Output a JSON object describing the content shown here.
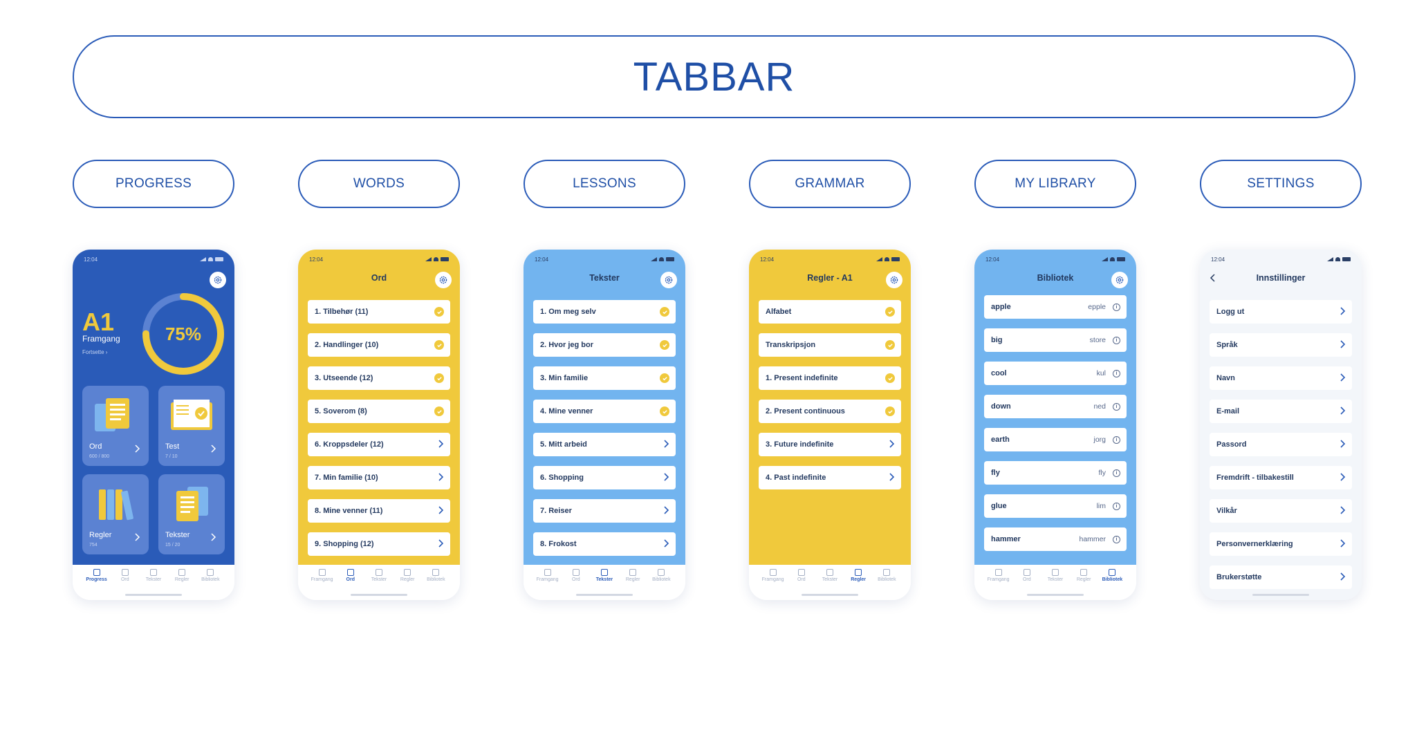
{
  "banner": "TABBAR",
  "pills": [
    "PROGRESS",
    "WORDS",
    "LESSONS",
    "GRAMMAR",
    "MY LIBRARY",
    "SETTINGS"
  ],
  "time": "12:04",
  "tabs": [
    "Framgang",
    "Ord",
    "Tekster",
    "Regler",
    "Bibliotek"
  ],
  "progress": {
    "tabs": [
      "Progress",
      "Ord",
      "Tekster",
      "Regler",
      "Bibliotek"
    ],
    "level": "A1",
    "level_sub": "Framgang",
    "continue": "Fortsette",
    "percent_label": "75%",
    "percent": 0.75,
    "cards": [
      {
        "title": "Ord",
        "sub": "600 / 800"
      },
      {
        "title": "Test",
        "sub": "7 / 10"
      },
      {
        "title": "Regler",
        "sub": "754"
      },
      {
        "title": "Tekster",
        "sub": "15 / 20"
      }
    ]
  },
  "words": {
    "title": "Ord",
    "items": [
      {
        "label": "1. Tilbehør (11)",
        "done": true
      },
      {
        "label": "2. Handlinger (10)",
        "done": true
      },
      {
        "label": "3. Utseende (12)",
        "done": true
      },
      {
        "label": "5. Soverom (8)",
        "done": true
      },
      {
        "label": "6. Kroppsdeler (12)",
        "done": false
      },
      {
        "label": "7. Min familie (10)",
        "done": false
      },
      {
        "label": "8. Mine venner (11)",
        "done": false
      },
      {
        "label": "9. Shopping (12)",
        "done": false
      }
    ]
  },
  "lessons": {
    "title": "Tekster",
    "items": [
      {
        "label": "1. Om meg selv",
        "done": true
      },
      {
        "label": "2. Hvor jeg bor",
        "done": true
      },
      {
        "label": "3. Min familie",
        "done": true
      },
      {
        "label": "4. Mine venner",
        "done": true
      },
      {
        "label": "5. Mitt arbeid",
        "done": false
      },
      {
        "label": "6. Shopping",
        "done": false
      },
      {
        "label": "7. Reiser",
        "done": false
      },
      {
        "label": "8. Frokost",
        "done": false
      }
    ]
  },
  "grammar": {
    "title": "Regler - A1",
    "items": [
      {
        "label": "Alfabet",
        "done": true
      },
      {
        "label": "Transkripsjon",
        "done": true
      },
      {
        "label": "1. Present indefinite",
        "done": true
      },
      {
        "label": "2. Present continuous",
        "done": true
      },
      {
        "label": "3. Future indefinite",
        "done": false
      },
      {
        "label": "4. Past indefinite",
        "done": false
      }
    ]
  },
  "library": {
    "title": "Bibliotek",
    "items": [
      {
        "en": "apple",
        "no": "epple"
      },
      {
        "en": "big",
        "no": "store"
      },
      {
        "en": "cool",
        "no": "kul"
      },
      {
        "en": "down",
        "no": "ned"
      },
      {
        "en": "earth",
        "no": "jorg"
      },
      {
        "en": "fly",
        "no": "fly"
      },
      {
        "en": "glue",
        "no": "lim"
      },
      {
        "en": "hammer",
        "no": "hammer"
      }
    ]
  },
  "settings": {
    "title": "Innstillinger",
    "items": [
      "Logg ut",
      "Språk",
      "Navn",
      "E-mail",
      "Passord",
      "Fremdrift - tilbakestill",
      "Vilkår",
      "Personvernerklæring",
      "Brukerstøtte"
    ]
  },
  "colors": {
    "blue": "#2a5bb8",
    "yellow": "#f0c93c",
    "sky": "#72b4ef",
    "navy": "#23395f"
  }
}
